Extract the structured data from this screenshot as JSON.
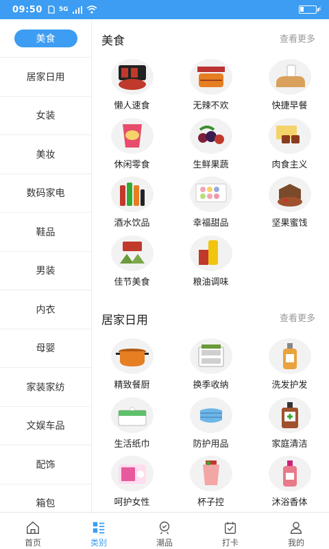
{
  "status": {
    "time": "09:50",
    "signal_text": "5G"
  },
  "sidebar": {
    "items": [
      {
        "label": "美食",
        "active": true
      },
      {
        "label": "居家日用"
      },
      {
        "label": "女装"
      },
      {
        "label": "美妆"
      },
      {
        "label": "数码家电"
      },
      {
        "label": "鞋品"
      },
      {
        "label": "男装"
      },
      {
        "label": "内衣"
      },
      {
        "label": "母婴"
      },
      {
        "label": "家装家纺"
      },
      {
        "label": "文娱车品"
      },
      {
        "label": "配饰"
      },
      {
        "label": "箱包"
      }
    ]
  },
  "sections": [
    {
      "title": "美食",
      "more": "查看更多",
      "items": [
        {
          "label": "懒人速食",
          "icon": "instant-noodles-icon",
          "color": "#c0392b"
        },
        {
          "label": "无辣不欢",
          "icon": "spicy-snack-icon",
          "color": "#e67e22"
        },
        {
          "label": "快捷早餐",
          "icon": "bread-icon",
          "color": "#d9a15b"
        },
        {
          "label": "休闲零食",
          "icon": "chips-icon",
          "color": "#e74c6c"
        },
        {
          "label": "生鲜果蔬",
          "icon": "berries-icon",
          "color": "#7d1f3a"
        },
        {
          "label": "肉食主义",
          "icon": "meat-icon",
          "color": "#8b3a1e"
        },
        {
          "label": "酒水饮品",
          "icon": "drinks-icon",
          "color": "#c0392b"
        },
        {
          "label": "幸福甜品",
          "icon": "macaron-icon",
          "color": "#f1a7b5"
        },
        {
          "label": "坚果蜜饯",
          "icon": "nuts-icon",
          "color": "#a0522d"
        },
        {
          "label": "佳节美食",
          "icon": "zongzi-icon",
          "color": "#c0392b"
        },
        {
          "label": "粮油调味",
          "icon": "oil-icon",
          "color": "#f1c40f"
        }
      ]
    },
    {
      "title": "居家日用",
      "more": "查看更多",
      "items": [
        {
          "label": "精致餐厨",
          "icon": "pot-icon",
          "color": "#e67e22"
        },
        {
          "label": "换季收纳",
          "icon": "storage-box-icon",
          "color": "#cfcfcf"
        },
        {
          "label": "洗发护发",
          "icon": "shampoo-icon",
          "color": "#e8a33c"
        },
        {
          "label": "生活纸巾",
          "icon": "tissue-icon",
          "color": "#5fbf6a"
        },
        {
          "label": "防护用品",
          "icon": "mask-icon",
          "color": "#6fb6e8"
        },
        {
          "label": "家庭清洁",
          "icon": "disinfectant-icon",
          "color": "#a0522d"
        },
        {
          "label": "呵护女性",
          "icon": "pad-icon",
          "color": "#e75a9c"
        },
        {
          "label": "杯子控",
          "icon": "cup-icon",
          "color": "#f2a6a6"
        },
        {
          "label": "沐浴香体",
          "icon": "body-wash-icon",
          "color": "#e87a8a"
        }
      ]
    }
  ],
  "tabbar": {
    "items": [
      {
        "label": "首页",
        "icon": "home-icon"
      },
      {
        "label": "类别",
        "icon": "category-icon",
        "active": true
      },
      {
        "label": "潮品",
        "icon": "trend-icon"
      },
      {
        "label": "打卡",
        "icon": "checkin-icon"
      },
      {
        "label": "我的",
        "icon": "user-icon"
      }
    ]
  }
}
